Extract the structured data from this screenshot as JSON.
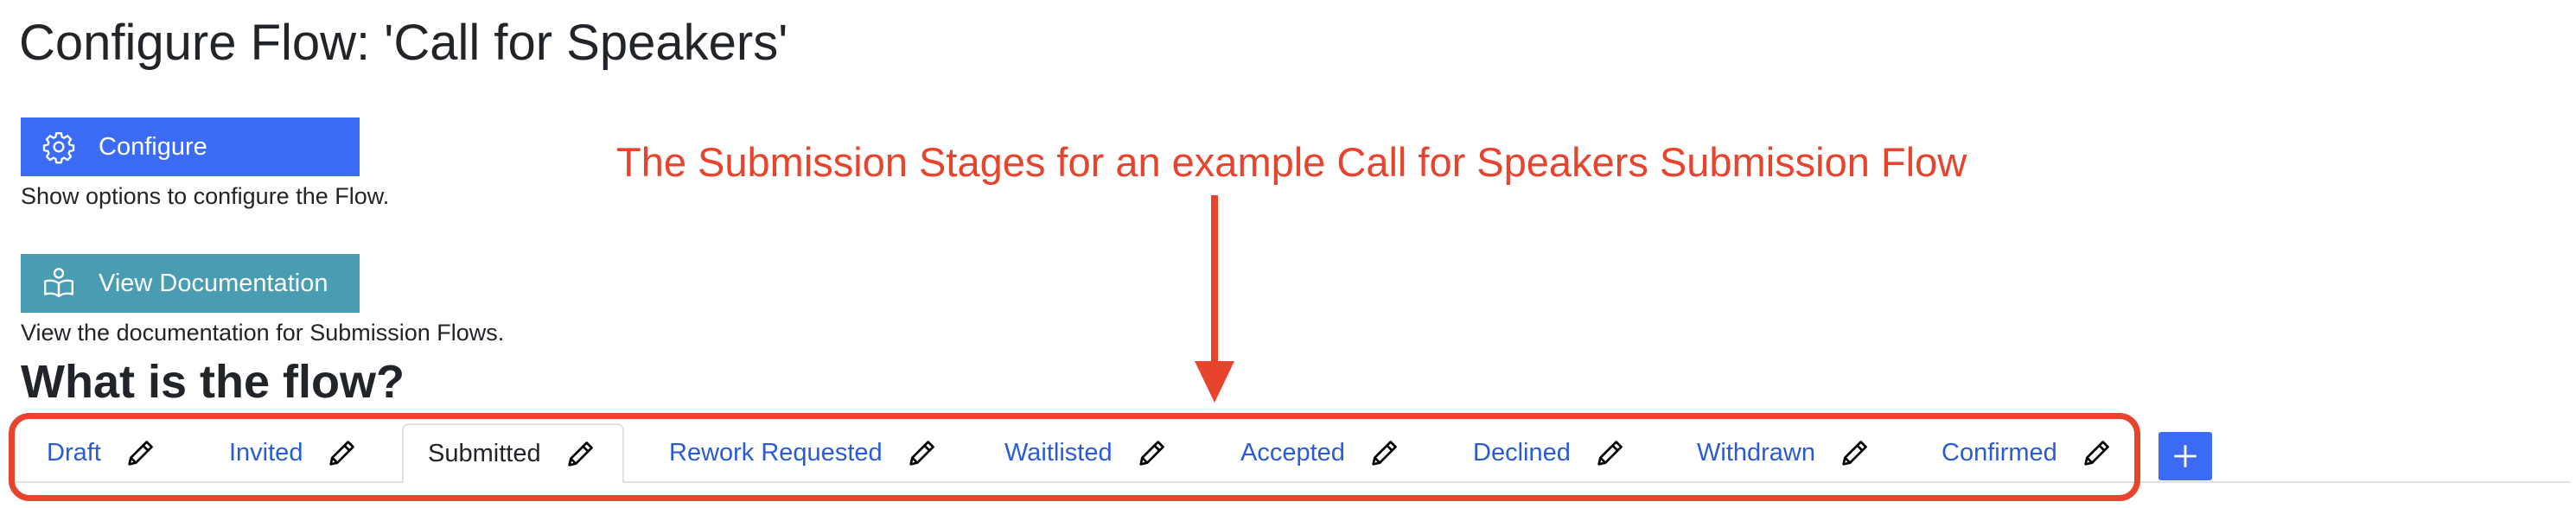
{
  "page": {
    "title": "Configure Flow: 'Call for Speakers'"
  },
  "actions": {
    "configure": {
      "label": "Configure",
      "icon": "gear-icon",
      "help": "Show options to configure the Flow."
    },
    "docs": {
      "label": "View Documentation",
      "icon": "book-icon",
      "help": "View the documentation for Submission Flows."
    }
  },
  "flow": {
    "heading": "What is the flow?",
    "active_tab": "Submitted",
    "tabs": [
      {
        "label": "Draft"
      },
      {
        "label": "Invited"
      },
      {
        "label": "Submitted"
      },
      {
        "label": "Rework Requested"
      },
      {
        "label": "Waitlisted"
      },
      {
        "label": "Accepted"
      },
      {
        "label": "Declined"
      },
      {
        "label": "Withdrawn"
      },
      {
        "label": "Confirmed"
      }
    ],
    "add_button": {
      "icon": "plus-icon"
    },
    "tab_icon": "pencil-icon"
  },
  "annotation": {
    "text": "The Submission Stages for an example Call for Speakers Submission Flow",
    "color": "#e8432c"
  },
  "colors": {
    "primary": "#3c6cf5",
    "info": "#4a9cb3",
    "link": "#2a5ad6"
  }
}
